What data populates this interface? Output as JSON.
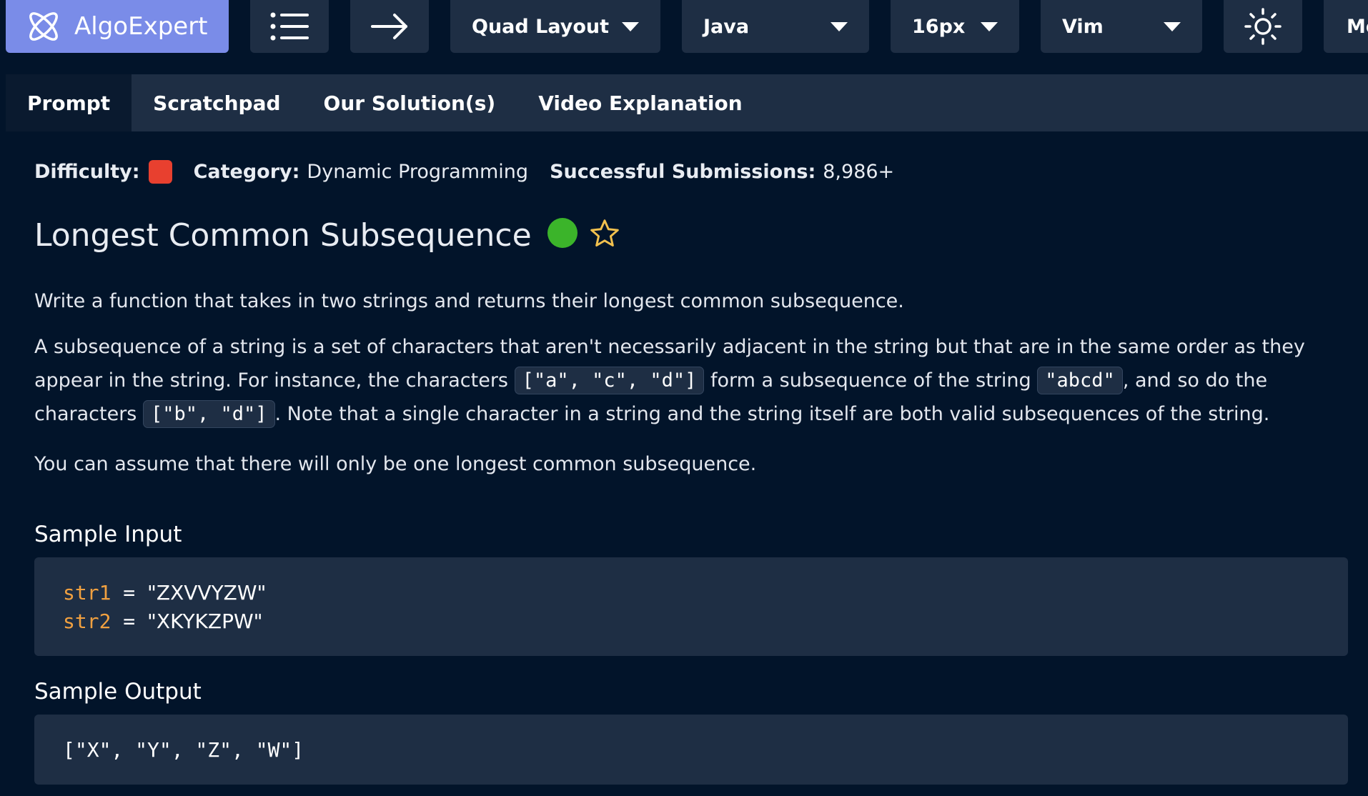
{
  "header": {
    "brand": "AlgoExpert",
    "layout_dropdown": "Quad Layout",
    "language_dropdown": "Java",
    "font_size_dropdown": "16px",
    "keybinding_dropdown": "Vim",
    "more_label": "Mo"
  },
  "tabs": [
    {
      "label": "Prompt",
      "active": true
    },
    {
      "label": "Scratchpad"
    },
    {
      "label": "Our Solution(s)"
    },
    {
      "label": "Video Explanation"
    }
  ],
  "meta": {
    "difficulty_label": "Difficulty:",
    "category_label": "Category:",
    "category_value": "Dynamic Programming",
    "submissions_label": "Successful Submissions:",
    "submissions_value": "8,986+",
    "difficulty_color": "#e8402f"
  },
  "question": {
    "title": "Longest Common Subsequence",
    "status_color": "#3bb42a",
    "p1": "Write a function that takes in two strings and returns their longest common subsequence.",
    "p2_a": "A subsequence of a string is a set of characters that aren't necessarily adjacent in the string but that are in the same order as they appear in the string. For instance, the characters ",
    "p2_code1": "[\"a\", \"c\", \"d\"]",
    "p2_b": " form a subsequence of the string ",
    "p2_code2": "\"abcd\"",
    "p2_c": ", and so do the characters ",
    "p2_code3": "[\"b\", \"d\"]",
    "p2_d": ". Note that a single character in a string and the string itself are both valid subsequences of the string.",
    "p3": "You can assume that there will only be one longest common subsequence."
  },
  "sample_input": {
    "heading": "Sample Input",
    "line1_var": "str1",
    "line1_eq": " = ",
    "line1_val": "\"ZXVVYZW\"",
    "line2_var": "str2",
    "line2_eq": " = ",
    "line2_val": "\"XKYKZPW\""
  },
  "sample_output": {
    "heading": "Sample Output",
    "value": "[\"X\", \"Y\", \"Z\", \"W\"]"
  }
}
